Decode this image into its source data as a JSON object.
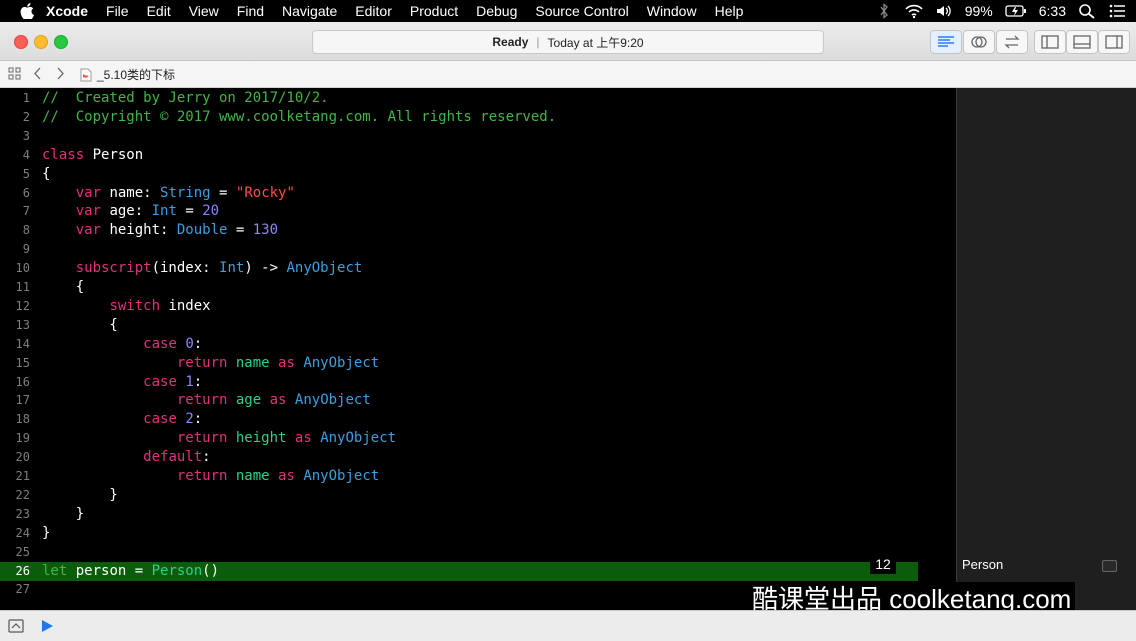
{
  "menubar": {
    "app": "Xcode",
    "items": [
      "File",
      "Edit",
      "View",
      "Find",
      "Navigate",
      "Editor",
      "Product",
      "Debug",
      "Source Control",
      "Window",
      "Help"
    ],
    "battery": "99%",
    "time": "6:33"
  },
  "toolbar": {
    "status": "Ready",
    "separator": "|",
    "timestamp": "Today at 上午9:20"
  },
  "jumpbar": {
    "filename": "_5.10类的下标"
  },
  "code": {
    "lines": [
      {
        "n": "1",
        "t": [
          [
            "c-com",
            "//  Created by Jerry on 2017/10/2."
          ]
        ]
      },
      {
        "n": "2",
        "t": [
          [
            "c-com",
            "//  Copyright © 2017 www.coolketang.com. All rights reserved."
          ]
        ]
      },
      {
        "n": "3",
        "t": []
      },
      {
        "n": "4",
        "t": [
          [
            "c-kw",
            "class"
          ],
          [
            "c-plain",
            " Person"
          ]
        ]
      },
      {
        "n": "5",
        "t": [
          [
            "c-plain",
            "{"
          ]
        ]
      },
      {
        "n": "6",
        "t": [
          [
            "c-plain",
            "    "
          ],
          [
            "c-kw",
            "var"
          ],
          [
            "c-plain",
            " name: "
          ],
          [
            "c-type",
            "String"
          ],
          [
            "c-plain",
            " = "
          ],
          [
            "c-str",
            "\"Rocky\""
          ]
        ]
      },
      {
        "n": "7",
        "t": [
          [
            "c-plain",
            "    "
          ],
          [
            "c-kw",
            "var"
          ],
          [
            "c-plain",
            " age: "
          ],
          [
            "c-type",
            "Int"
          ],
          [
            "c-plain",
            " = "
          ],
          [
            "c-num",
            "20"
          ]
        ]
      },
      {
        "n": "8",
        "t": [
          [
            "c-plain",
            "    "
          ],
          [
            "c-kw",
            "var"
          ],
          [
            "c-plain",
            " height: "
          ],
          [
            "c-type",
            "Double"
          ],
          [
            "c-plain",
            " = "
          ],
          [
            "c-num",
            "130"
          ]
        ]
      },
      {
        "n": "9",
        "t": []
      },
      {
        "n": "10",
        "t": [
          [
            "c-plain",
            "    "
          ],
          [
            "c-kw",
            "subscript"
          ],
          [
            "c-plain",
            "(index: "
          ],
          [
            "c-type",
            "Int"
          ],
          [
            "c-plain",
            ") -> "
          ],
          [
            "c-type",
            "AnyObject"
          ]
        ]
      },
      {
        "n": "11",
        "t": [
          [
            "c-plain",
            "    {"
          ]
        ]
      },
      {
        "n": "12",
        "t": [
          [
            "c-plain",
            "        "
          ],
          [
            "c-kw",
            "switch"
          ],
          [
            "c-plain",
            " index"
          ]
        ]
      },
      {
        "n": "13",
        "t": [
          [
            "c-plain",
            "        {"
          ]
        ]
      },
      {
        "n": "14",
        "t": [
          [
            "c-plain",
            "            "
          ],
          [
            "c-kw",
            "case"
          ],
          [
            "c-plain",
            " "
          ],
          [
            "c-num",
            "0"
          ],
          [
            "c-plain",
            ":"
          ]
        ]
      },
      {
        "n": "15",
        "t": [
          [
            "c-plain",
            "                "
          ],
          [
            "c-kw",
            "return"
          ],
          [
            "c-plain",
            " "
          ],
          [
            "c-prop",
            "name"
          ],
          [
            "c-plain",
            " "
          ],
          [
            "c-kw",
            "as"
          ],
          [
            "c-plain",
            " "
          ],
          [
            "c-type",
            "AnyObject"
          ]
        ]
      },
      {
        "n": "16",
        "t": [
          [
            "c-plain",
            "            "
          ],
          [
            "c-kw",
            "case"
          ],
          [
            "c-plain",
            " "
          ],
          [
            "c-num",
            "1"
          ],
          [
            "c-plain",
            ":"
          ]
        ]
      },
      {
        "n": "17",
        "t": [
          [
            "c-plain",
            "                "
          ],
          [
            "c-kw",
            "return"
          ],
          [
            "c-plain",
            " "
          ],
          [
            "c-prop",
            "age"
          ],
          [
            "c-plain",
            " "
          ],
          [
            "c-kw",
            "as"
          ],
          [
            "c-plain",
            " "
          ],
          [
            "c-type",
            "AnyObject"
          ]
        ]
      },
      {
        "n": "18",
        "t": [
          [
            "c-plain",
            "            "
          ],
          [
            "c-kw",
            "case"
          ],
          [
            "c-plain",
            " "
          ],
          [
            "c-num",
            "2"
          ],
          [
            "c-plain",
            ":"
          ]
        ]
      },
      {
        "n": "19",
        "t": [
          [
            "c-plain",
            "                "
          ],
          [
            "c-kw",
            "return"
          ],
          [
            "c-plain",
            " "
          ],
          [
            "c-prop",
            "height"
          ],
          [
            "c-plain",
            " "
          ],
          [
            "c-kw",
            "as"
          ],
          [
            "c-plain",
            " "
          ],
          [
            "c-type",
            "AnyObject"
          ]
        ]
      },
      {
        "n": "20",
        "t": [
          [
            "c-plain",
            "            "
          ],
          [
            "c-kw",
            "default"
          ],
          [
            "c-plain",
            ":"
          ]
        ]
      },
      {
        "n": "21",
        "t": [
          [
            "c-plain",
            "                "
          ],
          [
            "c-kw",
            "return"
          ],
          [
            "c-plain",
            " "
          ],
          [
            "c-prop",
            "name"
          ],
          [
            "c-plain",
            " "
          ],
          [
            "c-kw",
            "as"
          ],
          [
            "c-plain",
            " "
          ],
          [
            "c-type",
            "AnyObject"
          ]
        ]
      },
      {
        "n": "22",
        "t": [
          [
            "c-plain",
            "        }"
          ]
        ]
      },
      {
        "n": "23",
        "t": [
          [
            "c-plain",
            "    }"
          ]
        ]
      },
      {
        "n": "24",
        "t": [
          [
            "c-plain",
            "}"
          ]
        ]
      },
      {
        "n": "25",
        "t": []
      },
      {
        "n": "26",
        "t": [
          [
            "c-kw",
            "let"
          ],
          [
            "c-plain",
            " person = "
          ],
          [
            "c-prop",
            "Person"
          ],
          [
            "c-plain",
            "()"
          ]
        ],
        "current": true
      },
      {
        "n": "27",
        "t": []
      }
    ],
    "exec_count": "12"
  },
  "results": {
    "value": "Person"
  },
  "watermark": "酷课堂出品 coolketang.com",
  "colors": {
    "comment": "#41b645",
    "keyword": "#e2317c",
    "type": "#3c9fe0",
    "string": "#ff4b4b",
    "number": "#8b87ff",
    "current_line": "#0b5d0b"
  },
  "icons": {
    "navigator": "grid-icon",
    "back": "chevron-left-icon",
    "forward": "chevron-right-icon",
    "file": "swift-file-icon",
    "run": "play-icon",
    "console": "console-toggle-icon"
  }
}
